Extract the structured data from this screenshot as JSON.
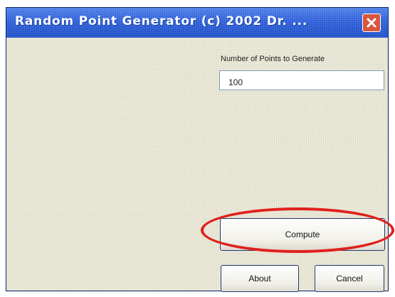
{
  "window": {
    "title": "Random Point Generator  (c) 2002 Dr. ..."
  },
  "icons": {
    "close": "close-icon"
  },
  "form": {
    "points_label": "Number of Points to Generate",
    "points_value": "100"
  },
  "buttons": {
    "compute": "Compute",
    "about": "About",
    "cancel": "Cancel"
  },
  "colors": {
    "titlebar": "#2c59d6",
    "close_button": "#d8573d",
    "highlight": "#e0201b"
  }
}
